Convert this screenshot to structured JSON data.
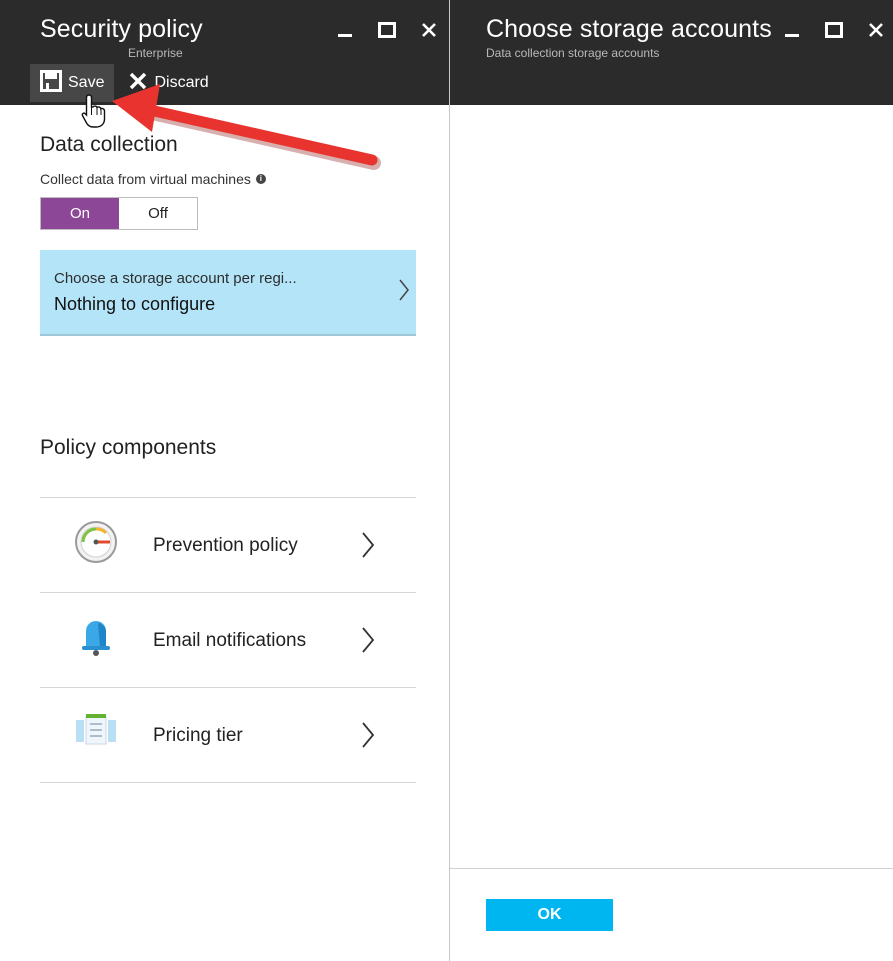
{
  "security_blade": {
    "title": "Security policy",
    "subtitle": "Enterprise",
    "commands": {
      "save": "Save",
      "discard": "Discard"
    },
    "data_collection": {
      "heading": "Data collection",
      "label": "Collect data from virtual machines",
      "toggle_on": "On",
      "toggle_off": "Off",
      "selected": "On"
    },
    "storage_tile": {
      "line1": "Choose a storage account per regi...",
      "line2": "Nothing to configure"
    },
    "policy_components": {
      "heading": "Policy components",
      "items": [
        {
          "label": "Prevention policy",
          "icon": "gauge-icon"
        },
        {
          "label": "Email notifications",
          "icon": "bell-icon"
        },
        {
          "label": "Pricing tier",
          "icon": "pricing-list-icon"
        }
      ]
    }
  },
  "storage_blade": {
    "title": "Choose storage accounts",
    "subtitle": "Data collection storage accounts",
    "ok_label": "OK"
  },
  "colors": {
    "header_bg": "#2b2b2b",
    "toggle_on": "#8c4797",
    "tile_bg": "#b3e4f8",
    "ok_button": "#00b6f0",
    "annotation_arrow": "#e8332e"
  }
}
